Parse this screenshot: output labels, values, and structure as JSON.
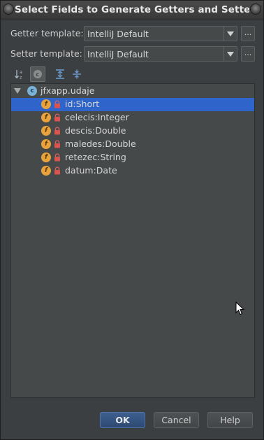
{
  "window": {
    "title": "Select Fields to Generate Getters and Setters"
  },
  "getter": {
    "label": "Getter template:",
    "value": "IntelliJ Default",
    "more": "..."
  },
  "setter": {
    "label": "Setter template:",
    "value": "IntelliJ Default",
    "more": "..."
  },
  "toolbar": {
    "icons": [
      "sort-alphabetically-icon",
      "show-classes-icon",
      "expand-all-icon",
      "collapse-all-icon"
    ]
  },
  "tree": {
    "root": {
      "icon": "c",
      "label": "jfxapp.udaje"
    },
    "fields": [
      {
        "icon": "f",
        "label": "id:Short",
        "selected": true
      },
      {
        "icon": "f",
        "label": "celecis:Integer"
      },
      {
        "icon": "f",
        "label": "descis:Double"
      },
      {
        "icon": "f",
        "label": "maledes:Double"
      },
      {
        "icon": "f",
        "label": "retezec:String"
      },
      {
        "icon": "f",
        "label": "datum:Date"
      }
    ]
  },
  "buttons": {
    "ok": "OK",
    "cancel": "Cancel",
    "help": "Help"
  },
  "colors": {
    "selection": "#2f65ca",
    "field_icon": "#e8a33d",
    "class_icon": "#7ab3d8",
    "lock": "#d9534f"
  }
}
